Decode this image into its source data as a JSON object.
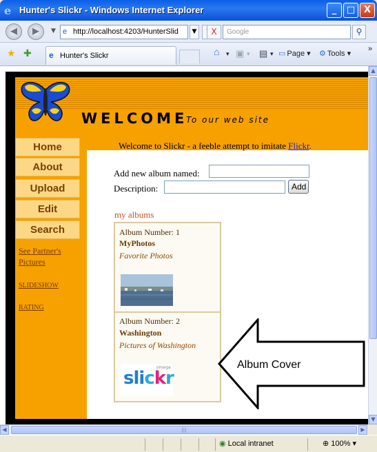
{
  "window": {
    "title": "Hunter's Slickr - Windows Internet Explorer",
    "minimize": "_",
    "maximize": "□",
    "close": "X"
  },
  "toolbar": {
    "back": "◀",
    "forward": "▶",
    "address": "http://localhost:4203/HunterSlid",
    "refresh": "↻",
    "stop": "X",
    "search_placeholder": "Google",
    "search_btn": "⚲"
  },
  "tabs": {
    "active_label": "Hunter's Slickr",
    "home_icon": "⌂",
    "feeds_icon": "▣",
    "print_icon": "▤",
    "page_label": "Page",
    "tools_label": "Tools",
    "more": "»"
  },
  "header": {
    "welcome": "WELCOME",
    "subtitle": "To our web site"
  },
  "nav": {
    "items": [
      "Home",
      "About",
      "Upload",
      "Edit",
      "Search"
    ],
    "links": [
      "See Partner's Pictures",
      "SLIDESHOW",
      "RATING"
    ]
  },
  "main": {
    "intro": "Welcome to Slickr - a feeble attempt to imitate ",
    "intro_link": "Flickr",
    "intro_end": ".",
    "album_label": "Add new album named:",
    "desc_label": "Description:",
    "add_button": "Add",
    "my_albums": "my albums",
    "albums": [
      {
        "number_text": "Album Number: 1",
        "name": "MyPhotos",
        "desc": "Favorite Photos"
      },
      {
        "number_text": "Album Number: 2",
        "name": "Washington",
        "desc": "Pictures of Washington"
      }
    ],
    "slickr_logo": "slickr",
    "slickr_logo_small": "omega"
  },
  "annotation": {
    "text": "Album Cover"
  },
  "status": {
    "zone": "Local intranet",
    "zoom": "100%"
  },
  "colors": {
    "orange": "#f6a100",
    "nav_button": "#fbd786",
    "link": "#1b1bd8",
    "my_albums": "#d2521f"
  }
}
